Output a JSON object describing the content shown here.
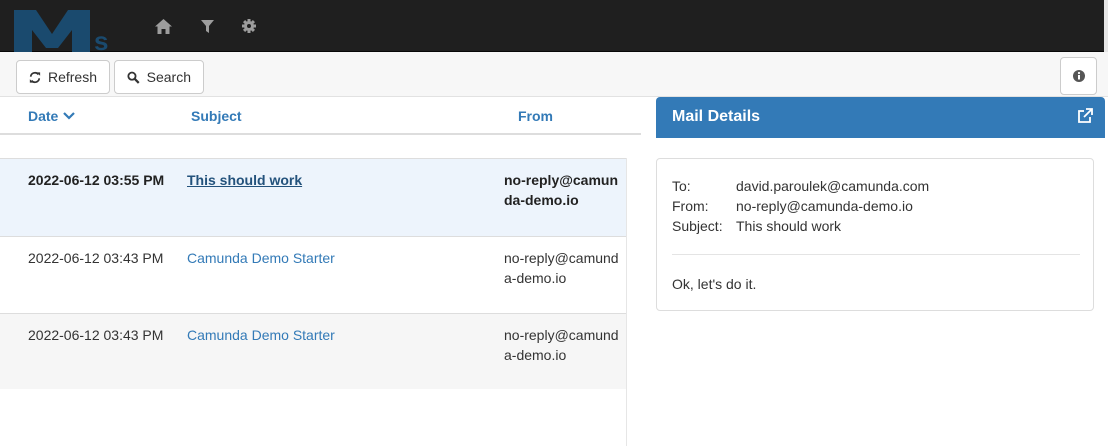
{
  "navbar": {
    "logo_text": "Ms",
    "icons": [
      "home-icon",
      "filter-icon",
      "gear-icon"
    ]
  },
  "toolbar": {
    "refresh_label": "Refresh",
    "search_label": "Search"
  },
  "list": {
    "headers": {
      "date": "Date",
      "subject": "Subject",
      "from": "From"
    },
    "rows": [
      {
        "date": "2022-06-12 03:55 PM",
        "subject": "This should work",
        "from": "no-reply@camunda-demo.io"
      },
      {
        "date": "2022-06-12 03:43 PM",
        "subject": "Camunda Demo Starter",
        "from": "no-reply@camunda-demo.io"
      },
      {
        "date": "2022-06-12 03:43 PM",
        "subject": "Camunda Demo Starter",
        "from": "no-reply@camunda-demo.io"
      }
    ]
  },
  "details": {
    "title": "Mail Details",
    "to_label": "To:",
    "to": "david.paroulek@camunda.com",
    "from_label": "From:",
    "from": "no-reply@camunda-demo.io",
    "subject_label": "Subject:",
    "subject": "This should work",
    "body": "Ok, let's do it."
  },
  "colors": {
    "navbar": "#1f1f1f",
    "accent": "#337ab7",
    "selected_row": "#edf4fc"
  }
}
